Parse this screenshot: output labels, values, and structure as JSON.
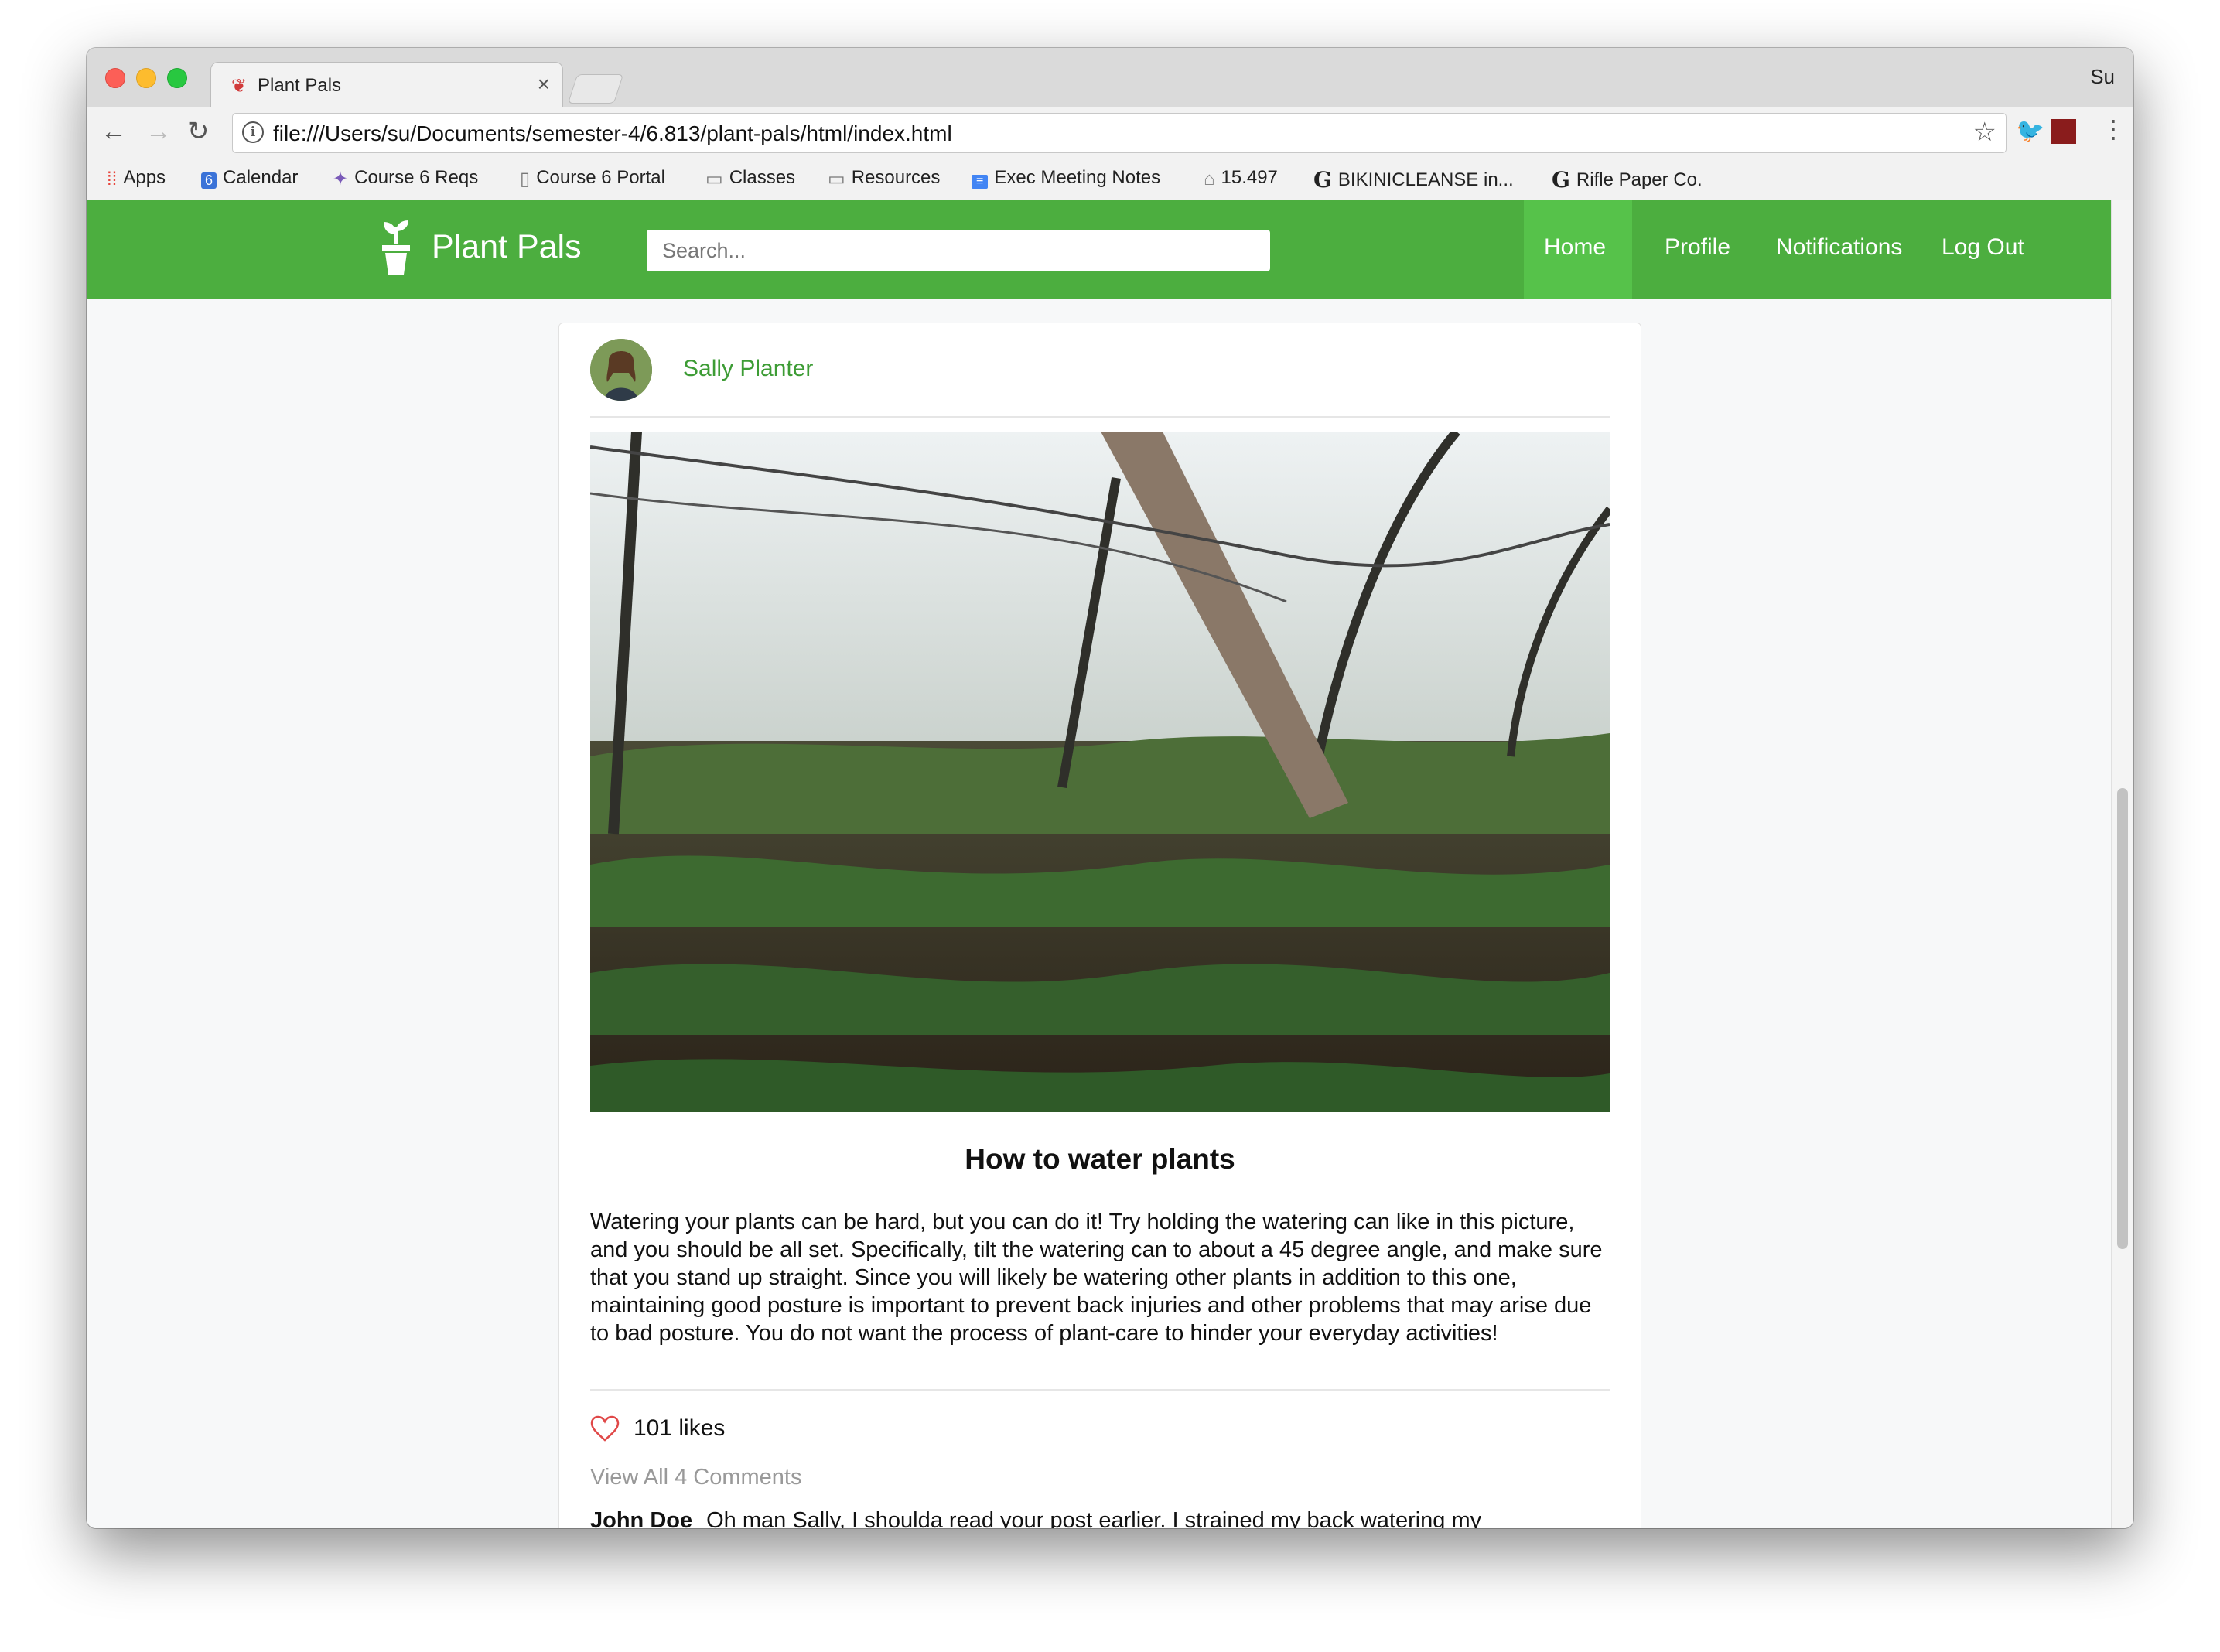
{
  "browser": {
    "tab_title": "Plant Pals",
    "tab_close": "×",
    "profile_name": "Su",
    "url": "file:///Users/su/Documents/semester-4/6.813/plant-pals/html/index.html",
    "nav": {
      "back": "←",
      "forward": "→",
      "reload": "↻"
    },
    "bookmarks": [
      {
        "label": "Apps",
        "icon": "apps-grid-icon"
      },
      {
        "label": "Calendar",
        "icon": "calendar-icon"
      },
      {
        "label": "Course 6 Reqs",
        "icon": "puzzle-icon"
      },
      {
        "label": "Course 6 Portal",
        "icon": "page-icon"
      },
      {
        "label": "Classes",
        "icon": "folder-icon"
      },
      {
        "label": "Resources",
        "icon": "folder-icon"
      },
      {
        "label": "Exec Meeting Notes",
        "icon": "docs-icon"
      },
      {
        "label": "15.497",
        "icon": "building-icon"
      },
      {
        "label": "BIKINICLEANSE in...",
        "icon": "g-icon"
      },
      {
        "label": "Rifle Paper Co.",
        "icon": "g-icon"
      }
    ]
  },
  "app": {
    "brand": "Plant Pals",
    "search_placeholder": "Search...",
    "nav": {
      "home": "Home",
      "profile": "Profile",
      "notifications": "Notifications",
      "logout": "Log Out"
    },
    "colors": {
      "primary": "#4cae3f",
      "active": "#56c24a",
      "author": "#3d9c35"
    }
  },
  "post": {
    "author": "Sally Planter",
    "title": "How to water plants",
    "body": "Watering your plants can be hard, but you can do it! Try holding the watering can like in this picture, and you should be all set. Specifically, tilt the watering can to about a 45 degree angle, and make sure that you stand up straight. Since you will likely be watering other plants in addition to this one, maintaining good posture is important to prevent back injuries and other problems that may arise due to bad posture. You do not want the process of plant-care to hinder your everyday activities!",
    "likes": "101 likes",
    "view_all_comments": "View All 4 Comments",
    "comments": [
      {
        "author": "John Doe",
        "text": "Oh man Sally, I shoulda read your post earlier. I strained my back watering my"
      }
    ]
  }
}
